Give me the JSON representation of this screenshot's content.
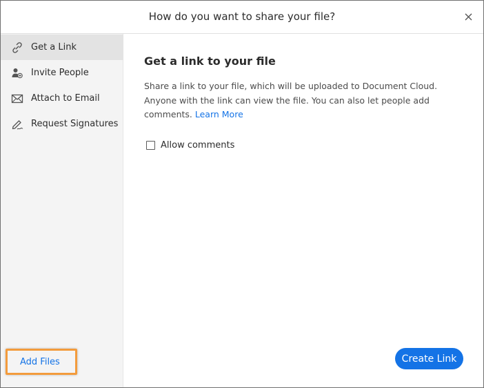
{
  "dialog": {
    "title": "How do you want to share your file?",
    "close_icon": "close-icon"
  },
  "sidebar": {
    "items": [
      {
        "label": "Get a Link",
        "icon": "link-icon",
        "active": true
      },
      {
        "label": "Invite People",
        "icon": "invite-people-icon",
        "active": false
      },
      {
        "label": "Attach to Email",
        "icon": "email-icon",
        "active": false
      },
      {
        "label": "Request Signatures",
        "icon": "signature-icon",
        "active": false
      }
    ],
    "add_files_label": "Add Files"
  },
  "main": {
    "title": "Get a link to your file",
    "description": "Share a link to your file, which will be uploaded to Document Cloud. Anyone with the link can view the file. You can also let people add comments.",
    "learn_more": "Learn More",
    "allow_comments_label": "Allow comments",
    "allow_comments_checked": false,
    "create_link_label": "Create Link"
  },
  "colors": {
    "accent": "#1473e6",
    "highlight": "#f39b3c",
    "sidebar_bg": "#f4f4f4",
    "active_item_bg": "#e3e3e3"
  }
}
